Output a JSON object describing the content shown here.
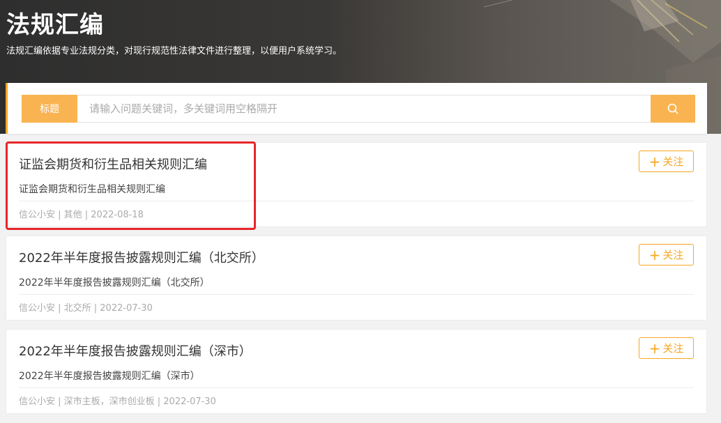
{
  "header": {
    "title": "法规汇编",
    "subtitle": "法规汇编依据专业法规分类，对现行规范性法律文件进行整理，以便用户系统学习。"
  },
  "search": {
    "tag_label": "标题",
    "placeholder": "请输入问题关键词，多关键词用空格隔开",
    "icon": "search-icon"
  },
  "follow_label": "关注",
  "follow_plus": "+",
  "colors": {
    "accent": "#f5a623",
    "highlight": "#e8262a"
  },
  "cards": [
    {
      "title": "证监会期货和衍生品相关规则汇编",
      "desc": "证监会期货和衍生品相关规则汇编",
      "meta": "信公小安 | 其他 | 2022-08-18"
    },
    {
      "title": "2022年半年度报告披露规则汇编（北交所）",
      "desc": "2022年半年度报告披露规则汇编（北交所）",
      "meta": "信公小安 | 北交所 | 2022-07-30"
    },
    {
      "title": "2022年半年度报告披露规则汇编（深市）",
      "desc": "2022年半年度报告披露规则汇编（深市）",
      "meta": "信公小安 | 深市主板，深市创业板 | 2022-07-30"
    }
  ]
}
